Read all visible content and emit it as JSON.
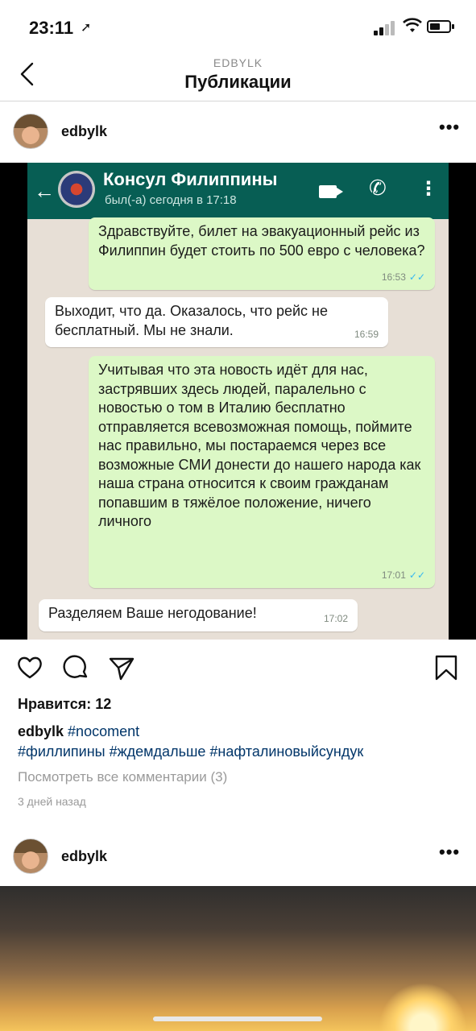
{
  "status": {
    "time": "23:11",
    "location_icon": "location-arrow-icon"
  },
  "header": {
    "subtitle": "EDBYLK",
    "title": "Публикации"
  },
  "post1": {
    "username": "edbylk",
    "image": {
      "contact_name": "Консул Филиппины",
      "last_seen": "был(-а) сегодня в 17:18",
      "messages": [
        {
          "dir": "out",
          "text": "Здравствуйте, билет на эвакуационный рейс из Филиппин будет стоить по 500 евро с человека?",
          "time": "16:53",
          "ticks": "✓✓"
        },
        {
          "dir": "in",
          "text": "Выходит, что да. Оказалось, что рейс не бесплатный. Мы не знали.",
          "time": "16:59"
        },
        {
          "dir": "out",
          "text": "Учитывая что эта новость идёт для нас, застрявших здесь людей, паралельно с новостью о том в Италию бесплатно отправляется всевозможная помощь, поймите нас правильно, мы постараемся через все возможные СМИ донести до нашего народа как наша страна относится к своим гражданам попавшим в тяжёлое положение, ничего личного",
          "time": "17:01",
          "ticks": "✓✓"
        },
        {
          "dir": "in",
          "text": "Разделяем Ваше негодование!",
          "time": "17:02"
        }
      ]
    },
    "likes": "Нравится: 12",
    "caption_user": "edbylk",
    "tags_line1": "#nocoment",
    "tags_line2": "#филлипины #ждемдальше #нафталиновыйсундук",
    "view_comments": "Посмотреть все комментарии (3)",
    "time_ago": "3 дней назад"
  },
  "post2": {
    "username": "edbylk"
  },
  "colors": {
    "wa_header": "#075e54",
    "wa_out": "#dcf8c6",
    "wa_bg": "#e7dfd6",
    "tag": "#003569"
  }
}
